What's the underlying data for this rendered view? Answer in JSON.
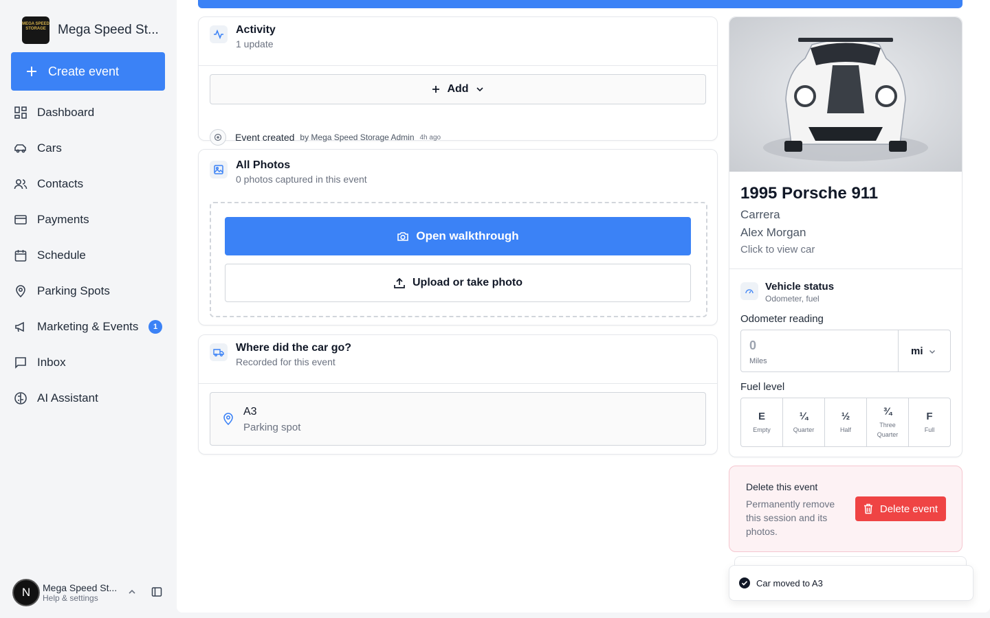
{
  "sidebar": {
    "brand_name": "Mega Speed St...",
    "logo_text": "MEGA SPEED STORAGE",
    "create_label": "Create event",
    "items": [
      {
        "label": "Dashboard"
      },
      {
        "label": "Cars"
      },
      {
        "label": "Contacts"
      },
      {
        "label": "Payments"
      },
      {
        "label": "Schedule"
      },
      {
        "label": "Parking Spots"
      },
      {
        "label": "Marketing & Events",
        "badge": "1"
      },
      {
        "label": "Inbox"
      },
      {
        "label": "AI Assistant"
      }
    ],
    "user": {
      "initial": "N",
      "name": "Mega Speed St...",
      "sub": "Help & settings"
    }
  },
  "activity": {
    "title": "Activity",
    "subtitle": "1 update",
    "add_label": "Add",
    "event_label": "Event created",
    "event_by": "by Mega Speed Storage Admin",
    "event_time": "4h ago"
  },
  "photos": {
    "title": "All Photos",
    "subtitle": "0 photos captured in this event",
    "walkthrough_label": "Open walkthrough",
    "upload_label": "Upload or take photo"
  },
  "location": {
    "title": "Where did the car go?",
    "subtitle": "Recorded for this event",
    "spot_name": "A3",
    "spot_type": "Parking spot"
  },
  "car": {
    "title": "1995 Porsche 911",
    "trim": "Carrera",
    "owner": "Alex Morgan",
    "link": "Click to view car"
  },
  "vehicle_status": {
    "title": "Vehicle status",
    "subtitle": "Odometer, fuel",
    "odometer_label": "Odometer reading",
    "odometer_value": "0",
    "odometer_units_label": "Miles",
    "unit": "mi",
    "fuel_label": "Fuel level",
    "fuel_levels": [
      {
        "symbol": "E",
        "name": "Empty"
      },
      {
        "symbol": "¼",
        "name": "Quarter"
      },
      {
        "symbol": "½",
        "name": "Half"
      },
      {
        "symbol": "¾",
        "name": "Three Quarter"
      },
      {
        "symbol": "F",
        "name": "Full"
      }
    ]
  },
  "danger": {
    "title": "Delete this event",
    "text": "Permanently remove this session and its photos.",
    "button": "Delete event"
  },
  "toast": {
    "message": "Car moved to A3"
  },
  "colors": {
    "accent": "#3b82f6",
    "danger": "#ef4444",
    "badge": "#3b82f6"
  }
}
